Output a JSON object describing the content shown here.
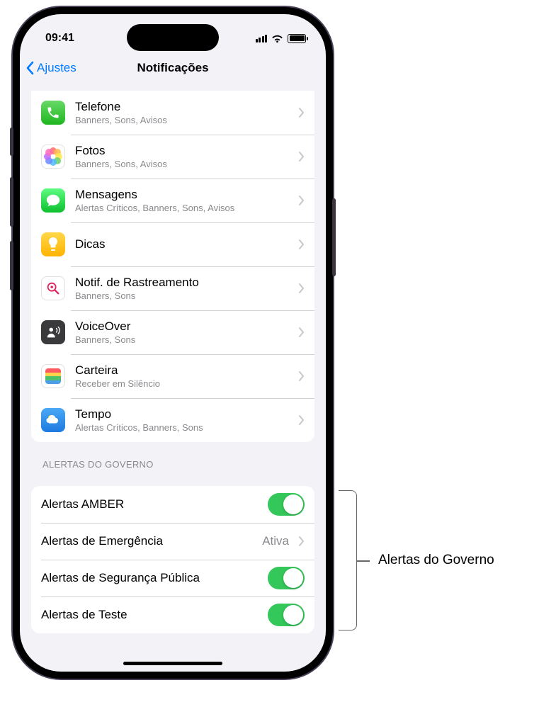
{
  "status": {
    "time": "09:41"
  },
  "nav": {
    "back": "Ajustes",
    "title": "Notificações"
  },
  "apps": [
    {
      "name": "Telefone",
      "sub": "Banners, Sons, Avisos",
      "icon": "phone"
    },
    {
      "name": "Fotos",
      "sub": "Banners, Sons, Avisos",
      "icon": "photos"
    },
    {
      "name": "Mensagens",
      "sub": "Alertas Críticos, Banners, Sons, Avisos",
      "icon": "messages"
    },
    {
      "name": "Dicas",
      "sub": "",
      "icon": "tips"
    },
    {
      "name": "Notif. de Rastreamento",
      "sub": "Banners, Sons",
      "icon": "tracking"
    },
    {
      "name": "VoiceOver",
      "sub": "Banners, Sons",
      "icon": "voiceover"
    },
    {
      "name": "Carteira",
      "sub": "Receber em Silêncio",
      "icon": "wallet"
    },
    {
      "name": "Tempo",
      "sub": "Alertas Críticos, Banners, Sons",
      "icon": "weather"
    }
  ],
  "gov": {
    "header": "ALERTAS DO GOVERNO",
    "amber": "Alertas AMBER",
    "emergency": "Alertas de Emergência",
    "emergency_value": "Ativa",
    "safety": "Alertas de Segurança Pública",
    "test": "Alertas de Teste"
  },
  "callout": "Alertas do Governo"
}
